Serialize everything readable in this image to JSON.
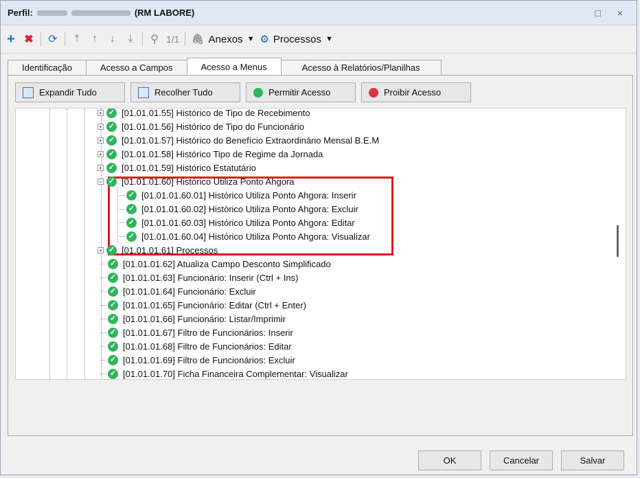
{
  "window": {
    "title_prefix": "Perfil:",
    "title_suffix": "(RM LABORE)",
    "controls": "□ ×"
  },
  "toolbar": {
    "page": "1/1",
    "anexos": "Anexos",
    "processos": "Processos"
  },
  "tabs": [
    "Identificação",
    "Acesso a Campos",
    "Acesso a Menus",
    "Acesso à Relatórios/Planilhas"
  ],
  "actions": {
    "expand": "Expandir Tudo",
    "collapse": "Recolher Tudo",
    "allow": "Permitir Acesso",
    "deny": "Proibir Acesso"
  },
  "tree": [
    {
      "label": "[01.01.01.55] Histórico de Tipo de Recebimento",
      "level": 0,
      "expand": "+"
    },
    {
      "label": "[01.01.01.56] Histórico de Tipo do Funcionário",
      "level": 0,
      "expand": "+"
    },
    {
      "label": "[01.01.01.57] Histórico do Benefício Extraordinário Mensal B.E.M",
      "level": 0,
      "expand": "+"
    },
    {
      "label": "[01.01.01.58] Histórico Tipo de Regime da Jornada",
      "level": 0,
      "expand": "+"
    },
    {
      "label": "[01.01.01.59] Histórico Estatutário",
      "level": 0,
      "expand": "+"
    },
    {
      "label": "[01.01.01.60] Histórico Utiliza Ponto Ahgora",
      "level": 0,
      "expand": "−"
    },
    {
      "label": "[01.01.01.60.01] Histórico Utiliza Ponto Ahgora: Inserir",
      "level": 1,
      "expand": ""
    },
    {
      "label": "[01.01.01.60.02] Histórico Utiliza Ponto Ahgora: Excluir",
      "level": 1,
      "expand": ""
    },
    {
      "label": "[01.01.01.60.03] Histórico Utiliza Ponto Ahgora: Editar",
      "level": 1,
      "expand": ""
    },
    {
      "label": "[01.01.01.60.04] Histórico Utiliza Ponto Ahgora: Visualizar",
      "level": 1,
      "expand": ""
    },
    {
      "label": "[01.01.01.61] Processos",
      "level": 0,
      "expand": "+"
    },
    {
      "label": "[01.01.01.62] Atualiza Campo Desconto Simplificado",
      "level": 0,
      "expand": ""
    },
    {
      "label": "[01.01.01.63] Funcionário: Inserir (Ctrl + Ins)",
      "level": 0,
      "expand": ""
    },
    {
      "label": "[01.01.01.64] Funcionário: Excluir",
      "level": 0,
      "expand": ""
    },
    {
      "label": "[01.01.01.65] Funcionário: Editar (Ctrl + Enter)",
      "level": 0,
      "expand": ""
    },
    {
      "label": "[01.01.01.66] Funcionário: Listar/Imprimir",
      "level": 0,
      "expand": ""
    },
    {
      "label": "[01.01.01.67] Filtro de Funcionários: Inserir",
      "level": 0,
      "expand": ""
    },
    {
      "label": "[01.01.01.68] Filtro de Funcionários: Editar",
      "level": 0,
      "expand": ""
    },
    {
      "label": "[01.01.01.69] Filtro de Funcionários: Excluir",
      "level": 0,
      "expand": ""
    },
    {
      "label": "[01.01.01.70] Ficha Financeira Complementar: Visualizar",
      "level": 0,
      "expand": ""
    }
  ],
  "footer": {
    "ok": "OK",
    "cancel": "Cancelar",
    "save": "Salvar"
  },
  "colors": {
    "check": "#2fb55d",
    "highlight": "#e0171f",
    "deny": "#d9363e"
  }
}
